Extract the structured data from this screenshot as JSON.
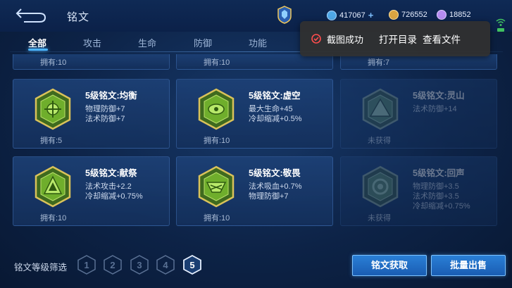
{
  "header": {
    "title": "铭文",
    "currencies": [
      {
        "name": "gem",
        "value": "417067",
        "color": "#4fa8e8"
      },
      {
        "name": "coin",
        "value": "726552",
        "color": "#d9a441"
      },
      {
        "name": "crystal",
        "value": "18852",
        "color": "#b58cf0"
      }
    ]
  },
  "tabs": [
    {
      "label": "全部",
      "active": true
    },
    {
      "label": "攻击",
      "active": false
    },
    {
      "label": "生命",
      "active": false
    },
    {
      "label": "防御",
      "active": false
    },
    {
      "label": "功能",
      "active": false
    }
  ],
  "partial_row": [
    "拥有:10",
    "拥有:10",
    "拥有:7"
  ],
  "cards": [
    {
      "name": "5级铭文:均衡",
      "attrs": [
        "物理防御+7",
        "法术防御+7"
      ],
      "owned": "拥有:5",
      "locked": false,
      "icon": "balance-inscription-icon"
    },
    {
      "name": "5级铭文:虚空",
      "attrs": [
        "最大生命+45",
        "冷却缩减+0.5%"
      ],
      "owned": "拥有:10",
      "locked": false,
      "icon": "void-inscription-icon"
    },
    {
      "name": "5级铭文:灵山",
      "attrs": [
        "法术防御+14"
      ],
      "owned": "未获得",
      "locked": true,
      "icon": "spirit-mountain-inscription-icon"
    },
    {
      "name": "5级铭文:献祭",
      "attrs": [
        "法术攻击+2.2",
        "冷却缩减+0.75%"
      ],
      "owned": "拥有:10",
      "locked": false,
      "icon": "sacrifice-inscription-icon"
    },
    {
      "name": "5级铭文:敬畏",
      "attrs": [
        "法术吸血+0.7%",
        "物理防御+7"
      ],
      "owned": "拥有:10",
      "locked": false,
      "icon": "awe-inscription-icon"
    },
    {
      "name": "5级铭文:回声",
      "attrs": [
        "物理防御+3.5",
        "法术防御+3.5",
        "冷却缩减+0.75%"
      ],
      "owned": "未获得",
      "locked": true,
      "icon": "echo-inscription-icon"
    }
  ],
  "filter": {
    "label": "铭文等级筛选",
    "levels": [
      "1",
      "2",
      "3",
      "4",
      "5"
    ],
    "selected": "5"
  },
  "buttons": {
    "obtain": "铭文获取",
    "sell": "批量出售"
  },
  "toast": {
    "message": "截图成功",
    "open_dir": "打开目录",
    "view_file": "查看文件"
  }
}
